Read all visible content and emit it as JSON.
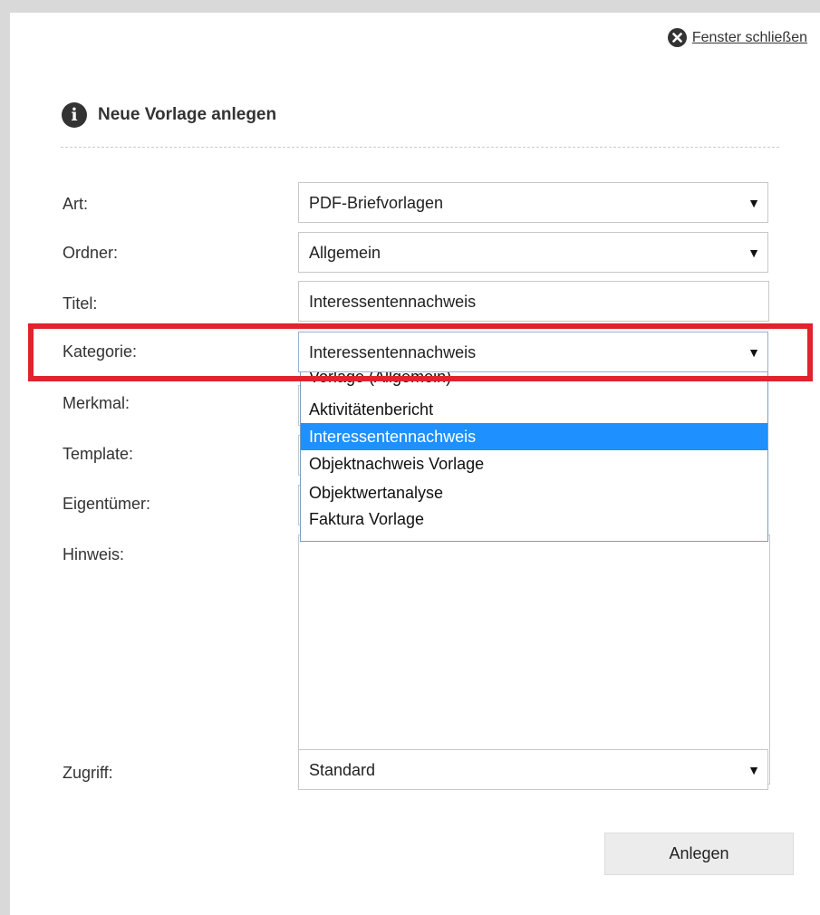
{
  "close_link": {
    "label": "Fenster schließen",
    "icon": "close-circle-icon"
  },
  "dialog": {
    "title": "Neue Vorlage anlegen",
    "icon": "info-icon"
  },
  "form": {
    "art": {
      "label": "Art:",
      "value": "PDF-Briefvorlagen"
    },
    "ordner": {
      "label": "Ordner:",
      "value": "Allgemein"
    },
    "titel": {
      "label": "Titel:",
      "value": "Interessentennachweis"
    },
    "kategorie": {
      "label": "Kategorie:",
      "value": "Interessentennachweis",
      "options": [
        "Vorlage (Allgemein)",
        "Aktivitätenbericht",
        "Interessentennachweis",
        "Objektnachweis Vorlage",
        "Objektwertanalyse",
        "Faktura Vorlage"
      ],
      "selected_index": 2
    },
    "merkmal": {
      "label": "Merkmal:"
    },
    "template": {
      "label": "Template:"
    },
    "eigentuemer": {
      "label": "Eigentümer:"
    },
    "hinweis": {
      "label": "Hinweis:",
      "value": ""
    },
    "zugriff": {
      "label": "Zugriff:",
      "value": "Standard"
    }
  },
  "submit_button": {
    "label": "Anlegen"
  },
  "dropdown_arrow": "▼",
  "colors": {
    "highlight": "#e0232d",
    "selected_option": "#1e90ff"
  }
}
